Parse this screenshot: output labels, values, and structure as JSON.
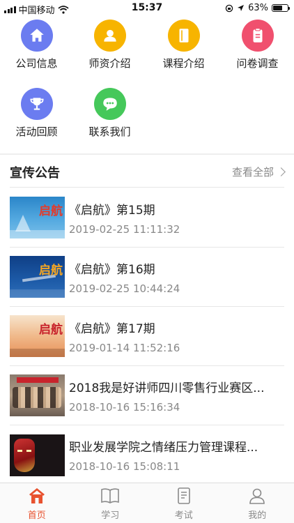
{
  "status_bar": {
    "carrier": "中国移动",
    "time": "15:37",
    "battery": "63%",
    "battery_level": 0.63
  },
  "menu": [
    {
      "label": "公司信息",
      "icon": "home-icon",
      "color": "#6b7cf0"
    },
    {
      "label": "师资介绍",
      "icon": "user-icon",
      "color": "#f7b400"
    },
    {
      "label": "课程介绍",
      "icon": "book-icon",
      "color": "#f7b400"
    },
    {
      "label": "问卷调查",
      "icon": "clipboard-icon",
      "color": "#f0506e"
    },
    {
      "label": "活动回顾",
      "icon": "trophy-icon",
      "color": "#6b7cf0"
    },
    {
      "label": "联系我们",
      "icon": "chat-icon",
      "color": "#45c85a"
    }
  ],
  "announcements": {
    "title": "宣传公告",
    "more_label": "查看全部",
    "items": [
      {
        "title": "《启航》第15期",
        "time": "2019-02-25 11:11:32"
      },
      {
        "title": "《启航》第16期",
        "time": "2019-02-25 10:44:24"
      },
      {
        "title": "《启航》第17期",
        "time": "2019-01-14 11:52:16"
      },
      {
        "title": "2018我是好讲师四川零售行业赛区...",
        "time": "2018-10-16 15:16:34"
      },
      {
        "title": "职业发展学院之情绪压力管理课程...",
        "time": "2018-10-16 15:08:11"
      }
    ]
  },
  "thumb_text": {
    "qihang": "启航"
  },
  "tabs": [
    {
      "label": "首页",
      "icon": "home-icon",
      "active": true
    },
    {
      "label": "学习",
      "icon": "book-icon",
      "active": false
    },
    {
      "label": "考试",
      "icon": "exam-icon",
      "active": false
    },
    {
      "label": "我的",
      "icon": "profile-icon",
      "active": false
    }
  ],
  "colors": {
    "accent": "#e8522f",
    "muted": "#888888"
  }
}
